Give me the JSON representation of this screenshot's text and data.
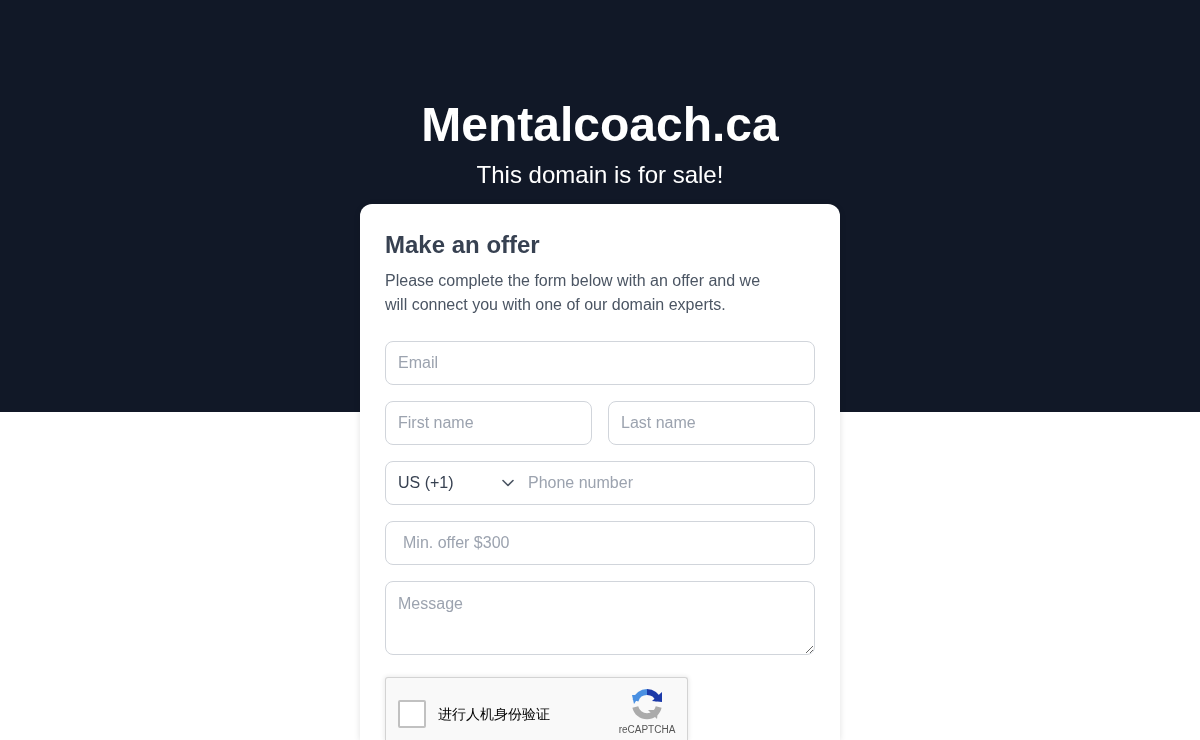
{
  "header": {
    "title": "Mentalcoach.ca",
    "subtitle": "This domain is for sale!"
  },
  "form": {
    "title": "Make an offer",
    "description": "Please complete the form below with an offer and we will connect you with one of our domain experts.",
    "email": {
      "placeholder": "Email"
    },
    "first_name": {
      "placeholder": "First name"
    },
    "last_name": {
      "placeholder": "Last name"
    },
    "phone": {
      "country_code": "US (+1)",
      "placeholder": "Phone number"
    },
    "offer": {
      "placeholder": "Min. offer $300"
    },
    "message": {
      "placeholder": "Message"
    },
    "captcha": {
      "checked": false,
      "label": "进行人机身份验证",
      "brand": "reCAPTCHA"
    }
  }
}
